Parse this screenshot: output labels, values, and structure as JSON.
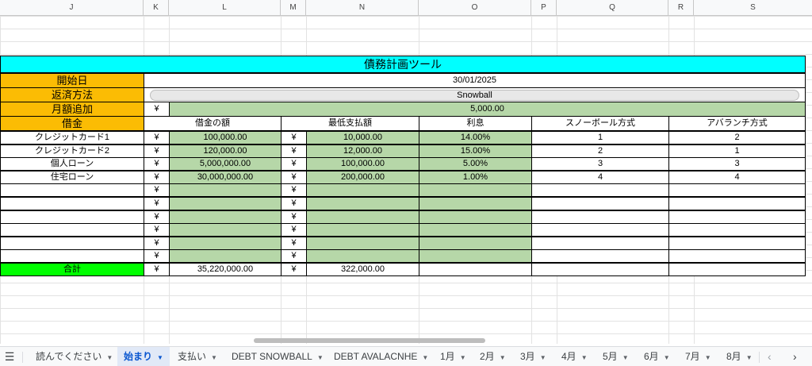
{
  "columns": [
    "J",
    "K",
    "L",
    "M",
    "N",
    "O",
    "P",
    "Q",
    "R",
    "S"
  ],
  "title": "債務計画ツール",
  "start_date": {
    "label": "開始日",
    "value": "30/01/2025"
  },
  "method": {
    "label": "返済方法",
    "value": "Snowball"
  },
  "monthly_extra": {
    "label": "月額追加",
    "currency": "¥",
    "value": "5,000.00"
  },
  "debt_header": {
    "label": "借金",
    "amount": "借金の額",
    "min_payment": "最低支払額",
    "interest": "利息",
    "snowball": "スノーボール方式",
    "avalanche": "アバランチ方式"
  },
  "debts": [
    {
      "name": "クレジットカード1",
      "cur1": "¥",
      "amount": "100,000.00",
      "cur2": "¥",
      "min": "10,000.00",
      "rate": "14.00%",
      "snowball": "1",
      "avalanche": "2"
    },
    {
      "name": "クレジットカード2",
      "cur1": "¥",
      "amount": "120,000.00",
      "cur2": "¥",
      "min": "12,000.00",
      "rate": "15.00%",
      "snowball": "2",
      "avalanche": "1"
    },
    {
      "name": "個人ローン",
      "cur1": "¥",
      "amount": "5,000,000.00",
      "cur2": "¥",
      "min": "100,000.00",
      "rate": "5.00%",
      "snowball": "3",
      "avalanche": "3"
    },
    {
      "name": "住宅ローン",
      "cur1": "¥",
      "amount": "30,000,000.00",
      "cur2": "¥",
      "min": "200,000.00",
      "rate": "1.00%",
      "snowball": "4",
      "avalanche": "4"
    },
    {
      "name": "",
      "cur1": "¥",
      "amount": "",
      "cur2": "¥",
      "min": "",
      "rate": "",
      "snowball": "",
      "avalanche": ""
    },
    {
      "name": "",
      "cur1": "¥",
      "amount": "",
      "cur2": "¥",
      "min": "",
      "rate": "",
      "snowball": "",
      "avalanche": ""
    },
    {
      "name": "",
      "cur1": "¥",
      "amount": "",
      "cur2": "¥",
      "min": "",
      "rate": "",
      "snowball": "",
      "avalanche": ""
    },
    {
      "name": "",
      "cur1": "¥",
      "amount": "",
      "cur2": "¥",
      "min": "",
      "rate": "",
      "snowball": "",
      "avalanche": ""
    },
    {
      "name": "",
      "cur1": "¥",
      "amount": "",
      "cur2": "¥",
      "min": "",
      "rate": "",
      "snowball": "",
      "avalanche": ""
    },
    {
      "name": "",
      "cur1": "¥",
      "amount": "",
      "cur2": "¥",
      "min": "",
      "rate": "",
      "snowball": "",
      "avalanche": ""
    }
  ],
  "total": {
    "label": "合計",
    "cur1": "¥",
    "amount": "35,220,000.00",
    "cur2": "¥",
    "min": "322,000.00"
  },
  "tabs": {
    "menu_icon": "hamburger-menu-icon",
    "items": [
      {
        "label": "読んでください",
        "active": false
      },
      {
        "label": "始まり",
        "active": true
      },
      {
        "label": "支払い",
        "active": false
      },
      {
        "label": "DEBT SNOWBALL",
        "active": false
      },
      {
        "label": "DEBT AVALACNHE",
        "active": false
      },
      {
        "label": "1月",
        "active": false
      },
      {
        "label": "2月",
        "active": false
      },
      {
        "label": "3月",
        "active": false
      },
      {
        "label": "4月",
        "active": false
      },
      {
        "label": "5月",
        "active": false
      },
      {
        "label": "6月",
        "active": false
      },
      {
        "label": "7月",
        "active": false
      },
      {
        "label": "8月",
        "active": false
      }
    ],
    "prev_icon": "chevron-left-icon",
    "next_icon": "chevron-right-icon"
  },
  "colors": {
    "title_bg": "#00ffff",
    "label_bg": "#fbbc04",
    "input_bg": "#b6d7a8",
    "total_label_bg": "#00ff00",
    "active_tab_bg": "#e1e9f7",
    "active_tab_text": "#0b57d0"
  }
}
